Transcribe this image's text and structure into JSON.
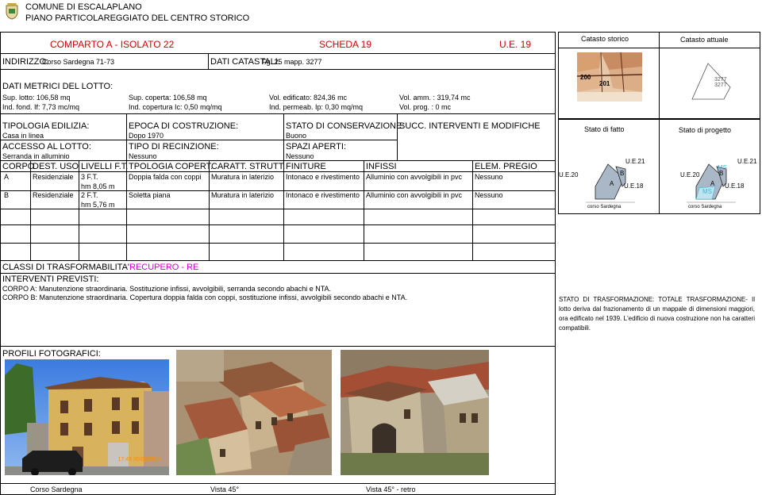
{
  "header": {
    "comune": "COMUNE DI ESCALAPLANO",
    "piano": "PIANO PARTICOLAREGGIATO DEL CENTRO STORICO"
  },
  "title_row": {
    "comparto": "COMPARTO A - ISOLATO 22",
    "scheda": "SCHEDA 19",
    "ue": "U.E. 19"
  },
  "address": {
    "label": "INDIRIZZO:",
    "value": "Corso Sardegna 71-73",
    "catastali_label": "DATI CATASTALI:",
    "catastali_value": "Fg. 25 mapp. 3277"
  },
  "metrics": {
    "title": "DATI METRICI DEL LOTTO:",
    "row1": [
      "Sup. lotto: 106,58 mq",
      "Sup. coperta: 106,58 mq",
      "Vol. edificato: 824,36 mc",
      "Vol. amm. : 319,74 mc"
    ],
    "row2": [
      "Ind. fond. If: 7,73 mc/mq",
      "Ind. copertura Ic: 0,50 mq/mq",
      "Ind. permeab. Ip: 0,30 mq/mq",
      "Vol. prog. : 0 mc"
    ]
  },
  "typology": {
    "tipologia_label": "TIPOLOGIA EDILIZIA:",
    "tipologia_value": "Casa in linea",
    "epoca_label": "EPOCA DI COSTRUZIONE:",
    "epoca_value": "Dopo 1970",
    "stato_label": "STATO DI CONSERVAZIONE:",
    "stato_value": "Buono",
    "succ_label": "SUCC. INTERVENTI E MODIFICHE",
    "accesso_label": "ACCESSO AL LOTTO:",
    "accesso_value": "Serranda in alluminio",
    "recinzione_label": "TIPO DI RECINZIONE:",
    "recinzione_value": "Nessuno",
    "spazi_label": "SPAZI APERTI:",
    "spazi_value": "Nessuno"
  },
  "table": {
    "headers": [
      "CORPO",
      "DEST. USO",
      "LIVELLI F.T.",
      "TPOLOGIA COPERT.",
      "CARATT. STRUTT.",
      "FINITURE",
      "INFISSI",
      "ELEM. PREGIO"
    ],
    "rows": [
      {
        "corpo": "A",
        "uso": "Residenziale",
        "livelli": "3 F.T.",
        "altezza": "hm 8,05 m",
        "copertura": "Doppia falda con coppi",
        "strutt": "Muratura in laterizio",
        "finiture": "Intonaco e rivestimento",
        "infissi": "Alluminio con avvolgibili in pvc",
        "pregio": "Nessuno"
      },
      {
        "corpo": "B",
        "uso": "Residenziale",
        "livelli": "2 F.T.",
        "altezza": "hm 5,76 m",
        "copertura": "Soletta piana",
        "strutt": "Muratura in laterizio",
        "finiture": "Intonaco e rivestimento",
        "infissi": "Alluminio con avvolgibili in pvc",
        "pregio": "Nessuno"
      }
    ]
  },
  "classi": {
    "label": "CLASSI DI TRASFORMABILITA':",
    "value": "RECUPERO - RE"
  },
  "interventi": {
    "label": "INTERVENTI PREVISTI:",
    "corpo_a": "CORPO A: Manutenzione straordinaria. Sostituzione infissi, avvolgibili, serranda secondo abachi e NTA.",
    "corpo_b": "CORPO B: Manutenzione straordinaria. Copertura doppia falda con coppi, sostituzione infissi, avvolgibili secondo abachi e NTA."
  },
  "profili": {
    "label": "PROFILI FOTOGRAFICI:",
    "captions": [
      "Corso Sardegna",
      "Vista 45°",
      "Vista 45° - retro"
    ],
    "photo_stamp": "17:45 30/08/2014"
  },
  "right_panel": {
    "catasto_storico": "Catasto storico",
    "catasto_attuale": "Catasto attuale",
    "storico_nums": [
      "200",
      "201"
    ],
    "attuale_nums": [
      "3277",
      "3277"
    ],
    "stato_fatto": "Stato di fatto",
    "stato_progetto": "Stato di progetto",
    "plan_labels": {
      "ue20": "U.E.20",
      "ue21": "U.E.21",
      "ue18": "U.E.18",
      "a": "A",
      "b": "B",
      "ms": "MS",
      "street": "corso Sardegna"
    },
    "stato_text": "STATO DI TRASFORMAZIONE: TOTALE TRASFORMAZIONE- Il lotto deriva dal frazionamento di un mappale di dimensioni maggiori, ora edificato nel 1939. L'edificio di nuova costruzione non ha caratteri compatibili."
  },
  "colors": {
    "red": "#d10000",
    "magenta": "#d000d0",
    "ms_cyan": "#3fb8d8"
  }
}
